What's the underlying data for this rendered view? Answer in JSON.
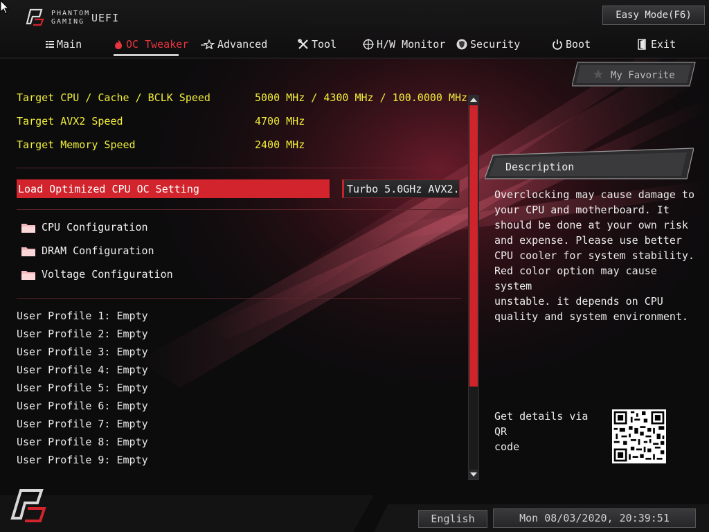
{
  "header": {
    "brand_line1": "PHANTOM",
    "brand_line2": "GAMING",
    "brand_uefi": "UEFI",
    "easy_mode_label": "Easy Mode(F6)"
  },
  "nav": {
    "tabs": [
      {
        "label": "Main",
        "icon": "list-icon"
      },
      {
        "label": "OC Tweaker",
        "icon": "flame-icon",
        "active": true
      },
      {
        "label": "Advanced",
        "icon": "star-icon"
      },
      {
        "label": "Tool",
        "icon": "tools-icon"
      },
      {
        "label": "H/W Monitor",
        "icon": "crosshair-icon"
      },
      {
        "label": "Security",
        "icon": "shield-icon"
      },
      {
        "label": "Boot",
        "icon": "power-icon"
      },
      {
        "label": "Exit",
        "icon": "exit-icon"
      }
    ]
  },
  "favorite": {
    "label": "My Favorite",
    "icon": "star-icon"
  },
  "main": {
    "targets": [
      {
        "label": "Target CPU / Cache / BCLK Speed",
        "value": "5000 MHz / 4300 MHz / 100.0000 MHz"
      },
      {
        "label": "Target AVX2 Speed",
        "value": "4700 MHz"
      },
      {
        "label": "Target Memory Speed",
        "value": "2400 MHz"
      }
    ],
    "selected_option": {
      "label": "Load Optimized CPU OC Setting",
      "value": "Turbo 5.0GHz AVX2..."
    },
    "folders": [
      {
        "label": "CPU Configuration",
        "icon": "folder-icon"
      },
      {
        "label": "DRAM Configuration",
        "icon": "folder-icon"
      },
      {
        "label": "Voltage Configuration",
        "icon": "folder-icon"
      }
    ],
    "profiles": [
      "User Profile 1: Empty",
      "User Profile 2: Empty",
      "User Profile 3: Empty",
      "User Profile 4: Empty",
      "User Profile 5: Empty",
      "User Profile 6: Empty",
      "User Profile 7: Empty",
      "User Profile 8: Empty",
      "User Profile 9: Empty"
    ]
  },
  "description": {
    "title": "Description",
    "lines": [
      "Overclocking may cause damage to",
      "your CPU and motherboard. It",
      "should be done at your own risk",
      "and expense. Please use better",
      "CPU cooler for system stability.",
      "Red color option may cause system",
      "unstable. it depends on CPU",
      "quality and system environment."
    ]
  },
  "qr": {
    "lines": [
      "Get details via QR",
      "code"
    ]
  },
  "footer": {
    "language": "English",
    "datetime": "Mon 08/03/2020, 20:39:51"
  },
  "colors": {
    "accent_red": "#d2242c",
    "target_yellow": "#f2ee3a",
    "active_tab": "#e8343f"
  }
}
